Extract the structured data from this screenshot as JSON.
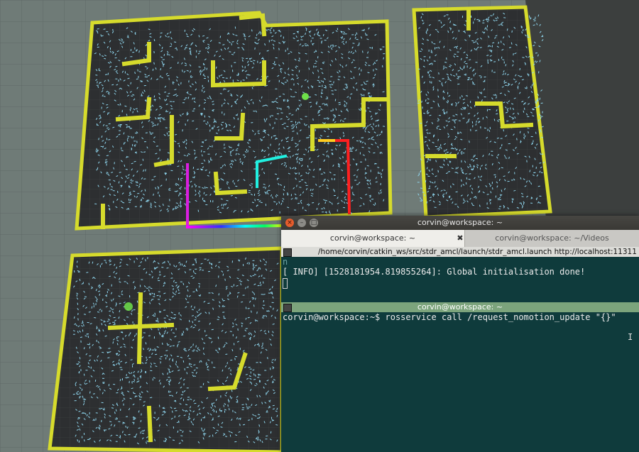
{
  "terminal": {
    "window_title": "corvin@workspace: ~",
    "tabs": [
      {
        "label": "corvin@workspace: ~",
        "active": true
      },
      {
        "label": "corvin@workspace: ~/Videos",
        "active": false
      }
    ],
    "top_pane": {
      "header": "/home/corvin/catkin_ws/src/stdr_amcl/launch/stdr_amcl.launch http://localhost:11311",
      "line_partial": "n",
      "line_info": "[ INFO] [1528181954.819855264]: Global initialisation done!"
    },
    "bottom_pane": {
      "header": "corvin@workspace: ~",
      "prompt": "corvin@workspace:~$ rosservice call /request_nomotion_update \"{}\""
    }
  },
  "colors": {
    "ground": "#6f7b77",
    "map_floor": "#2d2f31",
    "wall": "#d6db2c",
    "particle": "#8fd6ee",
    "terminal_bg": "#0f3b3c",
    "terminal_text": "#ebebeb",
    "pane_header_active": "#7ca47c"
  }
}
